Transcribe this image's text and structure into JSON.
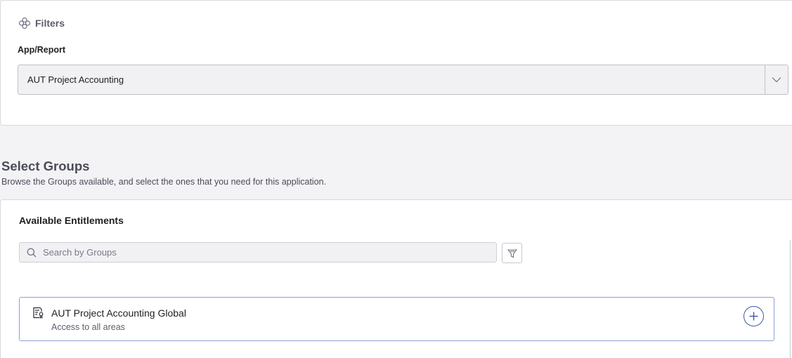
{
  "filters": {
    "title": "Filters",
    "icon": "filter-flower-icon",
    "app_report": {
      "label": "App/Report",
      "selected": "AUT Project Accounting"
    }
  },
  "groups_section": {
    "title": "Select Groups",
    "description": "Browse the Groups available, and select the ones that you need for this application."
  },
  "entitlements": {
    "title": "Available Entitlements",
    "search": {
      "placeholder": "Search by Groups",
      "value": ""
    },
    "items": [
      {
        "name": "AUT Project Accounting Global",
        "description": "Access to all areas",
        "icon": "certificate-document-icon",
        "action_icon": "add-circle-icon"
      }
    ]
  },
  "colors": {
    "accent": "#3d5aa8",
    "item_border": "#8e9fd9",
    "page_bg": "#f3f3f6"
  }
}
